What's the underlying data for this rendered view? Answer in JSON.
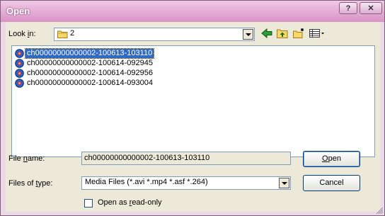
{
  "window": {
    "title": "Open",
    "help_label": "?",
    "close_label": "✕"
  },
  "lookin": {
    "label_pre": "Look ",
    "label_key": "i",
    "label_post": "n:",
    "value": "2"
  },
  "files": [
    {
      "name": "ch00000000000002-100613-103110",
      "selected": true
    },
    {
      "name": "ch00000000000002-100614-092945",
      "selected": false
    },
    {
      "name": "ch00000000000002-100614-092956",
      "selected": false
    },
    {
      "name": "ch00000000000002-100614-093004",
      "selected": false
    }
  ],
  "filename": {
    "label_pre": "File ",
    "label_key": "n",
    "label_post": "ame:",
    "value": "ch00000000000002-100613-103110"
  },
  "filetype": {
    "label_pre": "Files of ",
    "label_key": "t",
    "label_post": "ype:",
    "value": "Media Files (*.avi *.mp4 *.asf *.264)"
  },
  "readonly": {
    "label_pre": "Open as ",
    "label_key": "r",
    "label_post": "ead-only",
    "checked": false
  },
  "buttons": {
    "open_key": "O",
    "open_rest": "pen",
    "cancel": "Cancel"
  },
  "colors": {
    "selection": "#316ac5",
    "titlebar": "#d993c6",
    "dialog_bg": "#ece9d8"
  }
}
